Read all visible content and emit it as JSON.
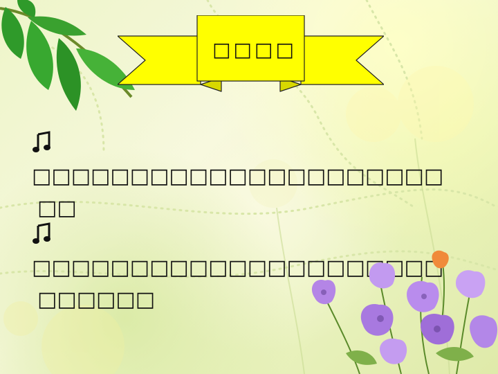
{
  "slide": {
    "banner_title": "□□□□",
    "bullets": [
      {
        "icon": "music-note-icon",
        "line1": "□□□□□□□□□□□□□□□□□□□□□",
        "line2": "□□"
      },
      {
        "icon": "music-note-icon",
        "line1": "□□□□□□□□□□□□□□□□□□□□□",
        "line2": "□□□□□□"
      }
    ]
  },
  "colors": {
    "banner": "#ffff00",
    "banner_outline": "#222222",
    "leaf": "#2f9a2a",
    "flower": "#b07be0"
  }
}
